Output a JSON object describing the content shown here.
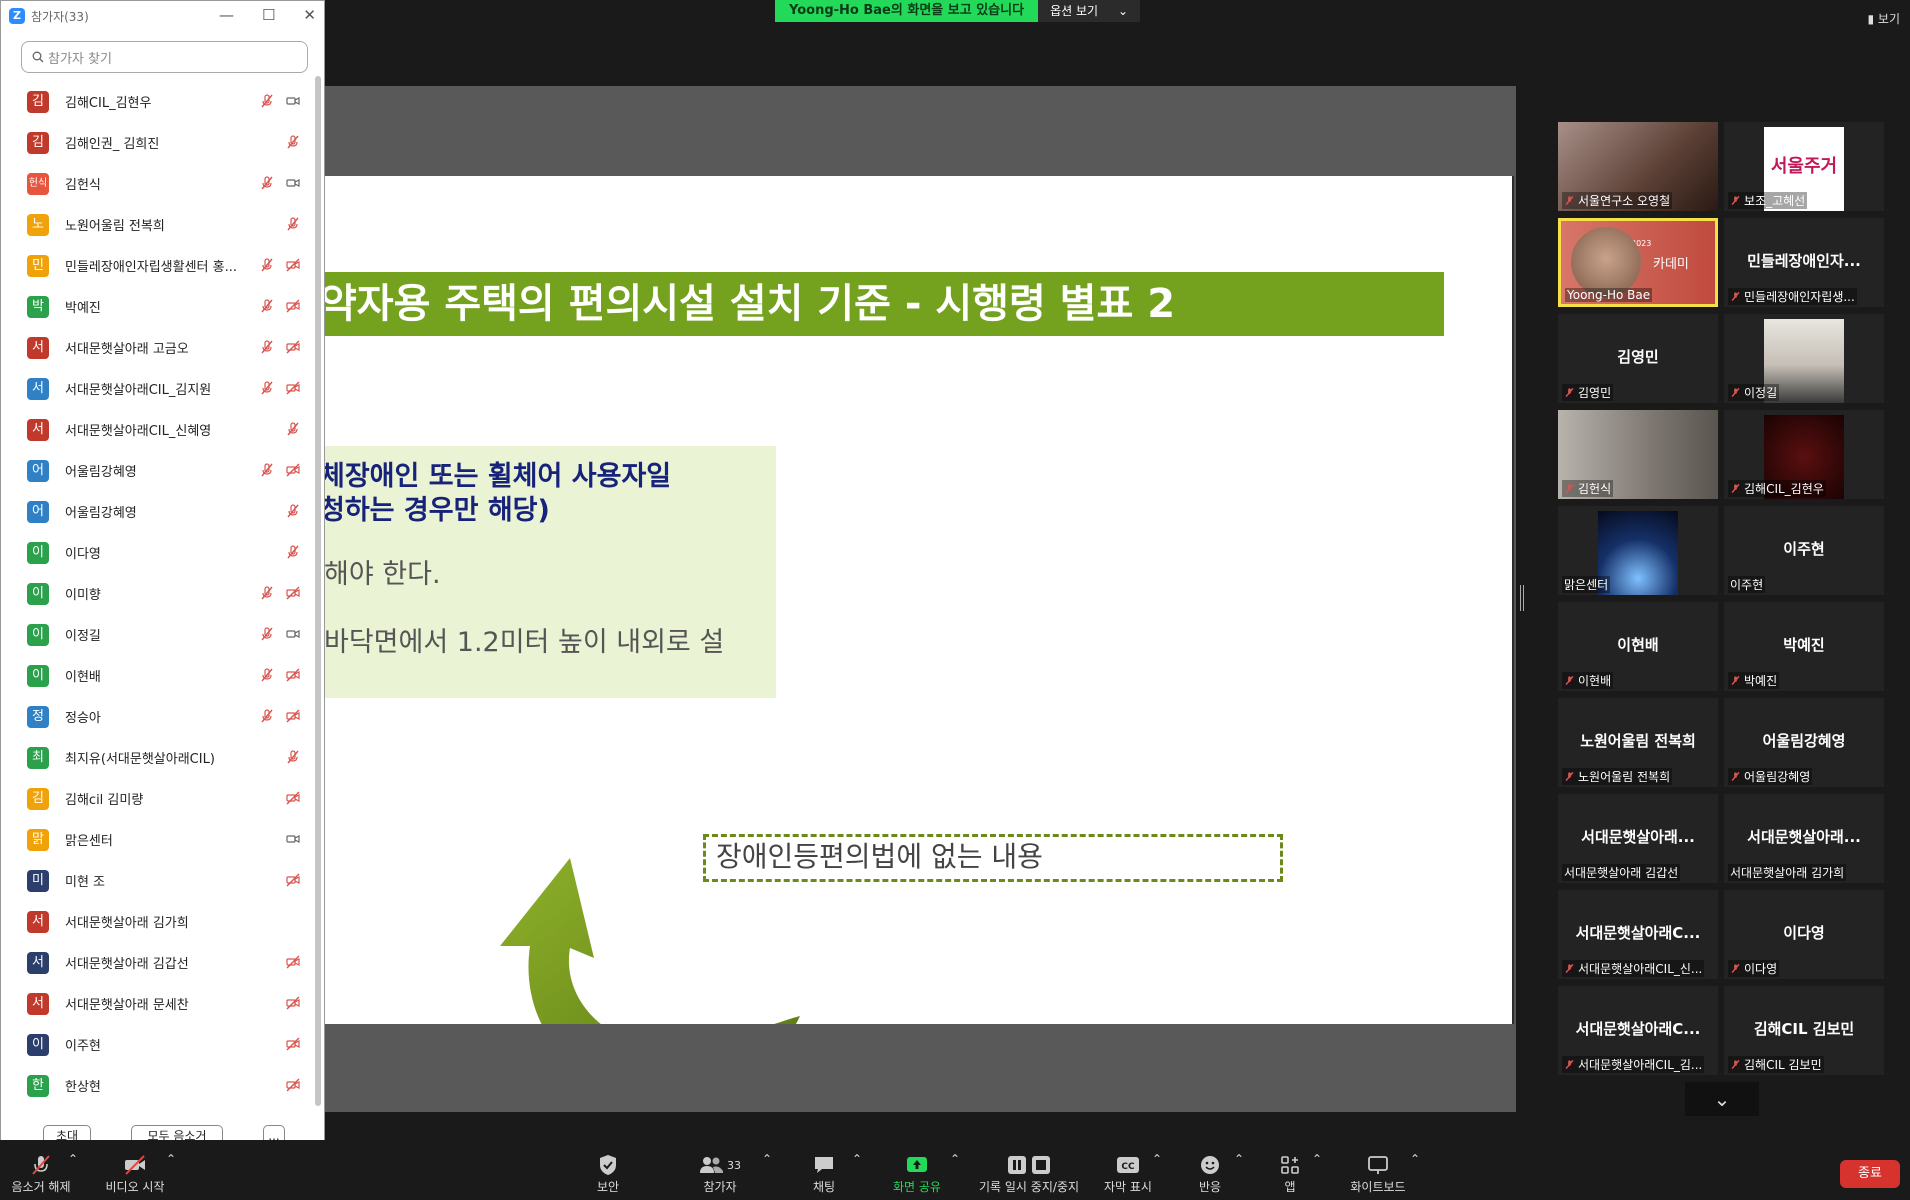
{
  "banner": {
    "message": "Yoong-Ho Bae의 화면을 보고 있습니다",
    "view_options": "옵션 보기",
    "caret": "⌄",
    "top_right_view": "보기"
  },
  "panel": {
    "title": "참가자(33)",
    "search_placeholder": "참가자 찾기",
    "participants": [
      {
        "initial": "김",
        "name": "김해CIL_김현우",
        "color": "#c0392b"
      },
      {
        "initial": "김",
        "name": "김해인권_ 김희진",
        "color": "#c0392b"
      },
      {
        "initial": "헌식",
        "name": "김헌식",
        "color": "#e8553e"
      },
      {
        "initial": "노",
        "name": "노원어울림 전복희",
        "color": "#f0a20a"
      },
      {
        "initial": "민",
        "name": "민들레장애인자립생활센터 홍...",
        "color": "#f0a20a"
      },
      {
        "initial": "박",
        "name": "박예진",
        "color": "#2aa14a"
      },
      {
        "initial": "서",
        "name": "서대문햇살아래 고금오",
        "color": "#c0392b"
      },
      {
        "initial": "서",
        "name": "서대문햇살아래CIL_김지원",
        "color": "#2f80c4"
      },
      {
        "initial": "서",
        "name": "서대문햇살아래CIL_신혜영",
        "color": "#c0392b"
      },
      {
        "initial": "어",
        "name": "어울림강혜영",
        "color": "#2f80c4"
      },
      {
        "initial": "어",
        "name": "어울림강혜영",
        "color": "#2f80c4"
      },
      {
        "initial": "이",
        "name": "이다영",
        "color": "#2aa14a"
      },
      {
        "initial": "이",
        "name": "이미향",
        "color": "#2aa14a"
      },
      {
        "initial": "이",
        "name": "이정길",
        "color": "#2aa14a"
      },
      {
        "initial": "이",
        "name": "이현배",
        "color": "#2aa14a"
      },
      {
        "initial": "정",
        "name": "정승아",
        "color": "#2f80c4"
      },
      {
        "initial": "최",
        "name": "최지유(서대문햇살아래CIL)",
        "color": "#2aa14a"
      },
      {
        "initial": "김",
        "name": "김해cil 김미량",
        "color": "#f0a20a"
      },
      {
        "initial": "맑",
        "name": "맑은센터",
        "color": "#f0a20a"
      },
      {
        "initial": "미",
        "name": "미현 조",
        "color": "#2c3e6b"
      },
      {
        "initial": "서",
        "name": "서대문햇살아래 김가희",
        "color": "#c0392b"
      },
      {
        "initial": "서",
        "name": "서대문햇살아래 김갑선",
        "color": "#2c3e6b"
      },
      {
        "initial": "서",
        "name": "서대문햇살아래 문세찬",
        "color": "#c0392b"
      },
      {
        "initial": "이",
        "name": "이주현",
        "color": "#2c3e6b"
      },
      {
        "initial": "한",
        "name": "한상현",
        "color": "#2aa14a"
      }
    ],
    "invite_label": "초대",
    "mute_all_label": "모두 음소거",
    "more_label": "..."
  },
  "slide": {
    "title": "약자용 주택의 편의시설 설치 기준 - 시행령 별표 2",
    "line1": "체장애인 또는 휠체어 사용자일",
    "line2": "청하는 경우만 해당)",
    "line3": "해야 한다.",
    "line4": "바닥면에서 1.2미터 높이 내외로 설",
    "callout": "장애인등편의법에 없는 내용"
  },
  "gallery": {
    "tiles": [
      {
        "big": "",
        "label": "서울연구소 오영철",
        "muted": true,
        "photo": "#6b4a3c"
      },
      {
        "big": "",
        "label": "보조_고혜선",
        "muted": true,
        "photo": "#ffffff"
      },
      {
        "big": "",
        "label": "Yoong-Ho Bae",
        "muted": false,
        "photo": "#c04a3d"
      },
      {
        "big": "민들레장애인자...",
        "label": "민들레장애인자립생...",
        "muted": true,
        "photo": ""
      },
      {
        "big": "김영민",
        "label": "김영민",
        "muted": true,
        "photo": ""
      },
      {
        "big": "",
        "label": "이정길",
        "muted": true,
        "photo": "#d9d6d0"
      },
      {
        "big": "",
        "label": "김헌식",
        "muted": true,
        "photo": "#8e8a86"
      },
      {
        "big": "",
        "label": "김해CIL_김현우",
        "muted": true,
        "photo": "#3d0a0a"
      },
      {
        "big": "",
        "label": "맑은센터",
        "muted": false,
        "photo": "#1b3a6e"
      },
      {
        "big": "이주현",
        "label": "이주현",
        "muted": false,
        "photo": ""
      },
      {
        "big": "이현배",
        "label": "이현배",
        "muted": true,
        "photo": ""
      },
      {
        "big": "박예진",
        "label": "박예진",
        "muted": true,
        "photo": ""
      },
      {
        "big": "노원어울림 전복희",
        "label": "노원어울림 전복희",
        "muted": true,
        "photo": ""
      },
      {
        "big": "어울림강혜영",
        "label": "어울림강혜영",
        "muted": true,
        "photo": ""
      },
      {
        "big": "서대문햇살아래...",
        "label": "서대문햇살아래 김갑선",
        "muted": false,
        "photo": ""
      },
      {
        "big": "서대문햇살아래...",
        "label": "서대문햇살아래 김가희",
        "muted": false,
        "photo": ""
      },
      {
        "big": "서대문햇살아래C...",
        "label": "서대문햇살아래CIL_신...",
        "muted": true,
        "photo": ""
      },
      {
        "big": "이다영",
        "label": "이다영",
        "muted": true,
        "photo": ""
      },
      {
        "big": "서대문햇살아래C...",
        "label": "서대문햇살아래CIL_김...",
        "muted": true,
        "photo": ""
      },
      {
        "big": "김해CIL 김보민",
        "label": "김해CIL 김보민",
        "muted": true,
        "photo": ""
      }
    ],
    "tile2_text": "카데미",
    "tile2_year": "2023",
    "tile1_logo": "서울주거"
  },
  "toolbar": {
    "unmute": "음소거 해제",
    "start_video": "비디오 시작",
    "security": "보안",
    "participants": "참가자",
    "participants_count": "33",
    "chat": "채팅",
    "share_screen": "화면 공유",
    "pause_record": "기록 일시 중지/중지",
    "captions": "자막 표시",
    "reactions": "반응",
    "apps": "앱",
    "whiteboard": "화이트보드",
    "end": "종료"
  },
  "colors": {
    "muted_red": "#d9534f",
    "share_green": "#23d959",
    "slide_green": "#74a21e"
  }
}
